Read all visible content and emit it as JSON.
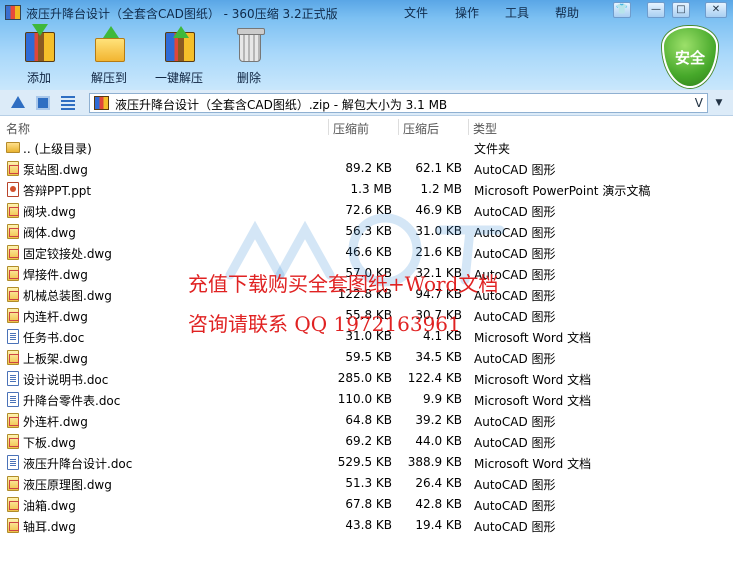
{
  "window": {
    "title": "液压升降台设计（全套含CAD图纸） - 360压缩 3.2正式版",
    "menu": [
      "文件",
      "操作",
      "工具",
      "帮助"
    ],
    "controls": {
      "minimize": "—",
      "maximize": "□",
      "close": "✕"
    }
  },
  "toolbar": {
    "add_label": "添加",
    "extract_to_label": "解压到",
    "one_click_label": "一键解压",
    "delete_label": "删除",
    "security_label": "安全"
  },
  "address": {
    "path": "液压升降台设计（全套含CAD图纸）.zip - 解包大小为 3.1 MB",
    "dropdown_glyph": "V"
  },
  "columns": {
    "name": "名称",
    "size": "压缩前",
    "compressed": "压缩后",
    "type": "类型"
  },
  "files": [
    {
      "icon": "folder",
      "name": ".. (上级目录)",
      "size": "",
      "compressed": "",
      "type": "文件夹"
    },
    {
      "icon": "dwg",
      "name": "泵站图.dwg",
      "size": "89.2 KB",
      "compressed": "62.1 KB",
      "type": "AutoCAD 图形"
    },
    {
      "icon": "ppt",
      "name": "答辩PPT.ppt",
      "size": "1.3 MB",
      "compressed": "1.2 MB",
      "type": "Microsoft PowerPoint 演示文稿"
    },
    {
      "icon": "dwg",
      "name": "阀块.dwg",
      "size": "72.6 KB",
      "compressed": "46.9 KB",
      "type": "AutoCAD 图形"
    },
    {
      "icon": "dwg",
      "name": "阀体.dwg",
      "size": "56.3 KB",
      "compressed": "31.0 KB",
      "type": "AutoCAD 图形"
    },
    {
      "icon": "dwg",
      "name": "固定铰接处.dwg",
      "size": "46.6 KB",
      "compressed": "21.6 KB",
      "type": "AutoCAD 图形"
    },
    {
      "icon": "dwg",
      "name": "焊接件.dwg",
      "size": "57.0 KB",
      "compressed": "32.1 KB",
      "type": "AutoCAD 图形"
    },
    {
      "icon": "dwg",
      "name": "机械总装图.dwg",
      "size": "122.8 KB",
      "compressed": "94.7 KB",
      "type": "AutoCAD 图形"
    },
    {
      "icon": "dwg",
      "name": "内连杆.dwg",
      "size": "55.8 KB",
      "compressed": "30.7 KB",
      "type": "AutoCAD 图形"
    },
    {
      "icon": "doc",
      "name": "任务书.doc",
      "size": "31.0 KB",
      "compressed": "4.1 KB",
      "type": "Microsoft Word 文档"
    },
    {
      "icon": "dwg",
      "name": "上板架.dwg",
      "size": "59.5 KB",
      "compressed": "34.5 KB",
      "type": "AutoCAD 图形"
    },
    {
      "icon": "doc",
      "name": "设计说明书.doc",
      "size": "285.0 KB",
      "compressed": "122.4 KB",
      "type": "Microsoft Word 文档"
    },
    {
      "icon": "doc",
      "name": "升降台零件表.doc",
      "size": "110.0 KB",
      "compressed": "9.9 KB",
      "type": "Microsoft Word 文档"
    },
    {
      "icon": "dwg",
      "name": "外连杆.dwg",
      "size": "64.8 KB",
      "compressed": "39.2 KB",
      "type": "AutoCAD 图形"
    },
    {
      "icon": "dwg",
      "name": "下板.dwg",
      "size": "69.2 KB",
      "compressed": "44.0 KB",
      "type": "AutoCAD 图形"
    },
    {
      "icon": "doc",
      "name": "液压升降台设计.doc",
      "size": "529.5 KB",
      "compressed": "388.9 KB",
      "type": "Microsoft Word 文档"
    },
    {
      "icon": "dwg",
      "name": "液压原理图.dwg",
      "size": "51.3 KB",
      "compressed": "26.4 KB",
      "type": "AutoCAD 图形"
    },
    {
      "icon": "dwg",
      "name": "油箱.dwg",
      "size": "67.8 KB",
      "compressed": "42.8 KB",
      "type": "AutoCAD 图形"
    },
    {
      "icon": "dwg",
      "name": "轴耳.dwg",
      "size": "43.8 KB",
      "compressed": "19.4 KB",
      "type": "AutoCAD 图形"
    }
  ],
  "watermark": {
    "line1": "充值下载购买全套图纸+Word文档",
    "line2": "咨询请联系  QQ 1972163961",
    "color": "#e02222"
  }
}
